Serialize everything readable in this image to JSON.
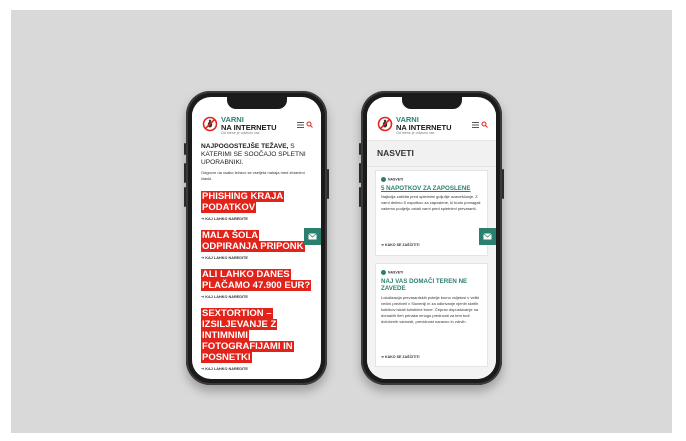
{
  "brand": {
    "line1": "VARNI",
    "line2": "NA INTERNETU",
    "tagline": "Od mene je odvisno vse",
    "accent_color": "#2b7f6f",
    "highlight_color": "#e2231a"
  },
  "icons": {
    "logo": "no-bug-logo-icon",
    "menu": "hamburger-menu-icon",
    "search": "search-icon",
    "mail": "envelope-icon",
    "arrow": "arrow-right-icon"
  },
  "left_phone": {
    "lead_bold": "NAJPOGOSTEJŠE TEŽAVE,",
    "lead_rest": " S KATERIMI SE SOOČAJO SPLETNI UPORABNIKI.",
    "sub": "Odgovor na vsako težavo se vseljeta nahaja med zbranimi članki.",
    "more_label": "KAJ LAHKO NAREDITE",
    "items": [
      {
        "title": "PHISHING KRAJA PODATKOV"
      },
      {
        "title": "MALA ŠOLA ODPIRANJA PRIPONK"
      },
      {
        "title": "ALI LAHKO DANES PLAČAMO 47.900 EUR?"
      },
      {
        "title": "SEXTORTION – IZSILJEVANJE Z INTIMNIMI FOTOGRAFIJAMI IN POSNETKI"
      }
    ]
  },
  "right_phone": {
    "section_title": "NASVETI",
    "cards": [
      {
        "tag": "NASVETI",
        "title": "5 NAPOTKOV ZA ZAPOSLENE",
        "body": "Najbolja zaščita pred spletnimi goljufije ozaveščanje. Z varni delimo 5 napotkov za zaposlene, ki bodo pomagali vašemu podjetju ostati varni pred spletnimi prevaranti.",
        "more": "KAKO SE ZAŠČITITI"
      },
      {
        "tag": "NASVETI",
        "title": "NAJ VAS DOMAČI TEREN NE ZAVEDE",
        "body": "Lokalizacija prevarantskih poletje bomo vsljetosi v velikl večini preživeli v Sloveniji in za odkrivanje njenih skritih kotičkov iskali turistične bone. Čeprav dopustovanje na domačih tleh prinaša mnogo prednosti za tem tudi določenih varnosti, previdnost naravno in zdrvih.",
        "more": "KAKO SE ZAŠČITITI"
      }
    ]
  }
}
